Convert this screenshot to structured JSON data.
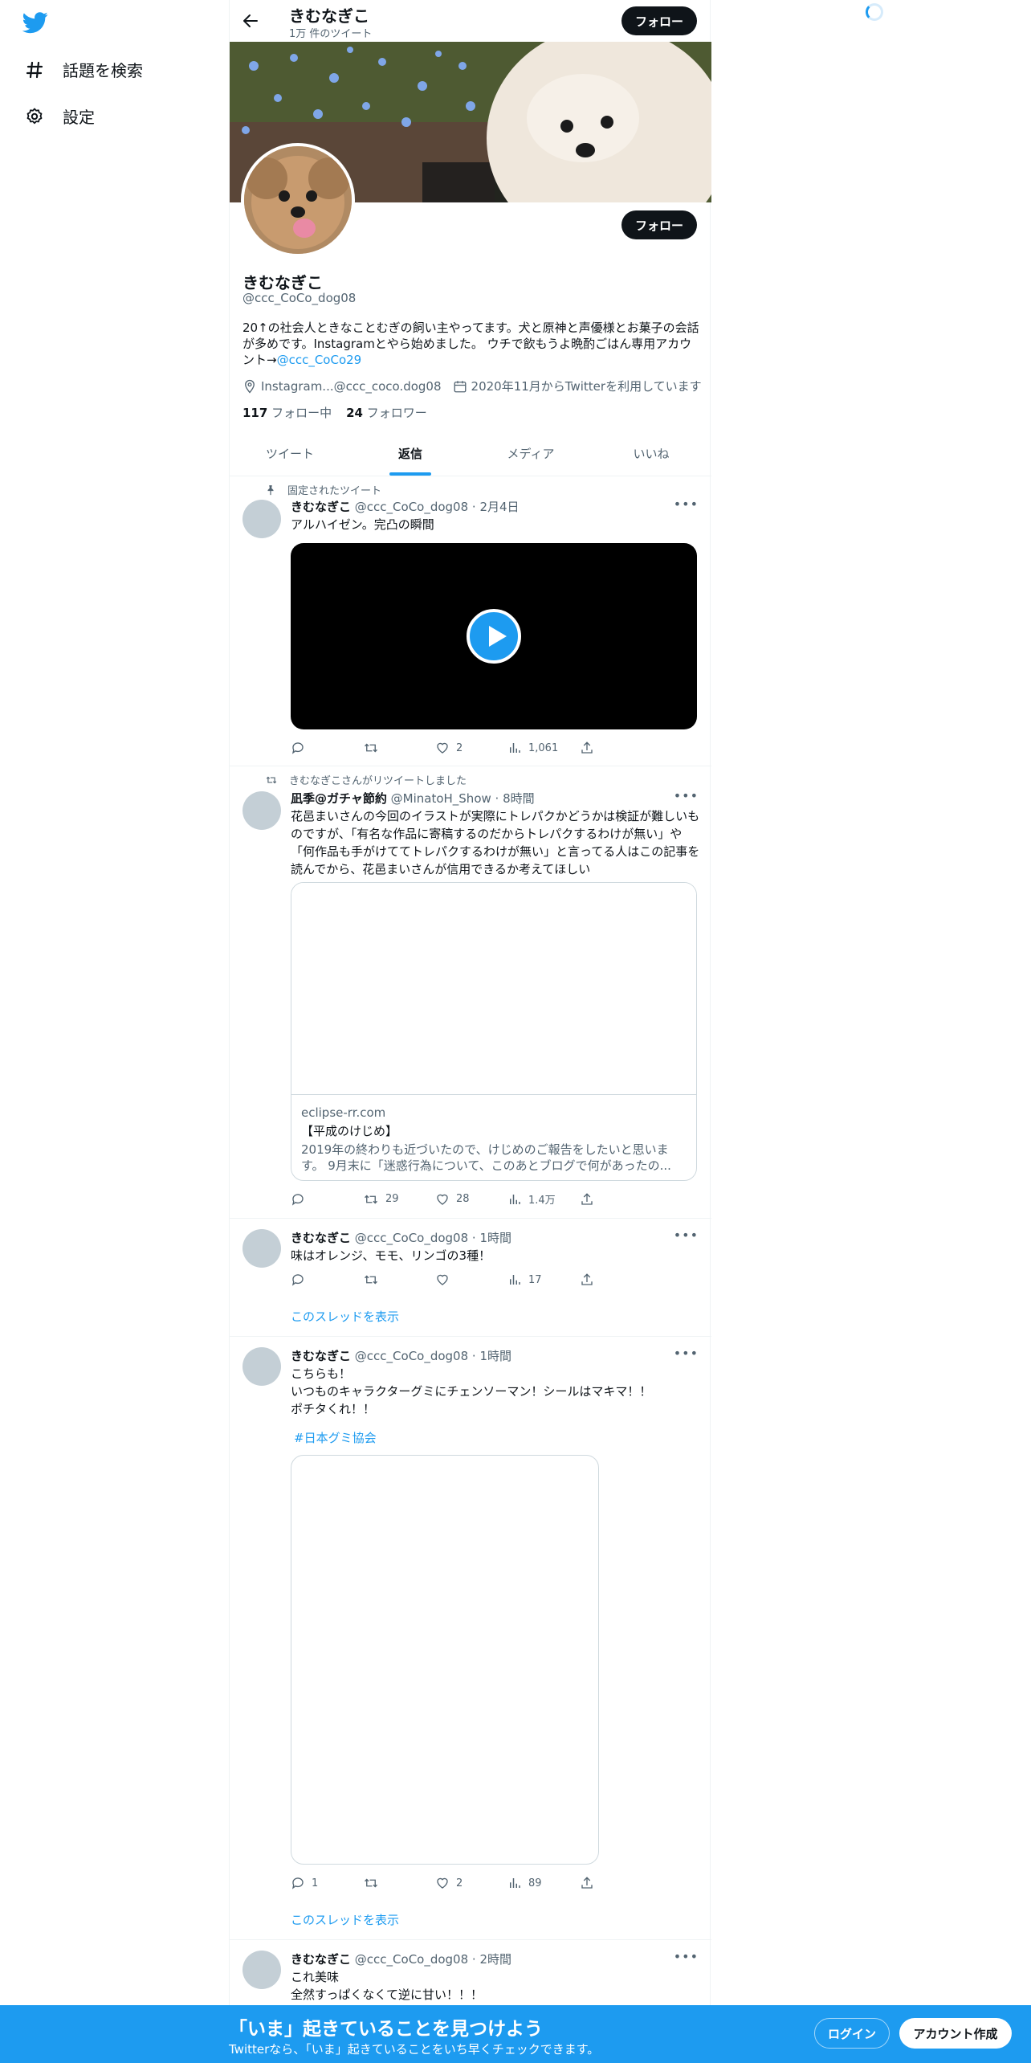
{
  "nav": {
    "explore_label": "話題を検索",
    "settings_label": "設定"
  },
  "header": {
    "name": "きむなぎこ",
    "tweet_count": "1万 件のツイート",
    "follow_label": "フォロー"
  },
  "profile": {
    "name": "きむなぎこ",
    "handle": "@ccc_CoCo_dog08",
    "follow_label": "フォロー",
    "bio_text": "20↑の社会人ときなことむぎの飼い主やってます。犬と原神と声優様とお菓子の会話が多めです。Instagramとやら始めました。 ウチで飲もうよ晩酌ごはん専用アカウント→",
    "bio_link": "@ccc_CoCo29",
    "location": "Instagram...@ccc_coco.dog08",
    "joined": "2020年11月からTwitterを利用しています",
    "following_count": "117",
    "following_label": "フォロー中",
    "followers_count": "24",
    "followers_label": "フォロワー"
  },
  "tabs": [
    {
      "label": "ツイート"
    },
    {
      "label": "返信"
    },
    {
      "label": "メディア"
    },
    {
      "label": "いいね"
    }
  ],
  "tweets": [
    {
      "context": "固定されたツイート",
      "name": "きむなぎこ",
      "handle": "@ccc_CoCo_dog08",
      "time": "2月4日",
      "text": "アルハイゼン。完凸の瞬間",
      "views": "1,061",
      "likes": "2"
    },
    {
      "context": "きむなぎこさんがリツイートしました",
      "name": "凪季@ガチャ節約",
      "handle": "@MinatoH_Show",
      "time": "8時間",
      "text": "花邑まいさんの今回のイラストが実際にトレパクかどうかは検証が難しいものですが、「有名な作品に寄稿するのだからトレパクするわけが無い」や「何作品も手がけててトレパクするわけが無い」と言ってる人はこの記事を読んでから、花邑まいさんが信用できるか考えてほしい",
      "card_domain": "eclipse-rr.com",
      "card_title": "【平成のけじめ】",
      "card_desc": "2019年の終わりも近づいたので、けじめのご報告をしたいと思います。 9月末に「迷惑行為について、このあとブログで何があったの...",
      "retweets": "29",
      "likes": "28",
      "views": "1.4万"
    },
    {
      "name": "きむなぎこ",
      "handle": "@ccc_CoCo_dog08",
      "time": "1時間",
      "text": "味はオレンジ、モモ、リンゴの3種！",
      "views": "17",
      "thread_link": "このスレッドを表示"
    },
    {
      "name": "きむなぎこ",
      "handle": "@ccc_CoCo_dog08",
      "time": "1時間",
      "text_lines": [
        "こちらも！",
        "いつものキャラクターグミにチェンソーマン！シールはマキマ！！",
        "ポチタくれ！！"
      ],
      "hashtag": "#日本グミ協会",
      "replies": "1",
      "likes": "2",
      "views": "89",
      "thread_link": "このスレッドを表示"
    },
    {
      "name": "きむなぎこ",
      "handle": "@ccc_CoCo_dog08",
      "time": "2時間",
      "text_lines": [
        "これ美味",
        "全然すっぱくなくて逆に甘い！！！"
      ]
    }
  ],
  "bottom": {
    "title": "「いま」起きていることを見つけよう",
    "subtitle": "Twitterなら、「いま」起きていることをいち早くチェックできます。",
    "login_label": "ログイン",
    "signup_label": "アカウント作成"
  },
  "colors": {
    "accent": "#1d9bf0",
    "text": "#0f1419",
    "muted": "#536471"
  }
}
